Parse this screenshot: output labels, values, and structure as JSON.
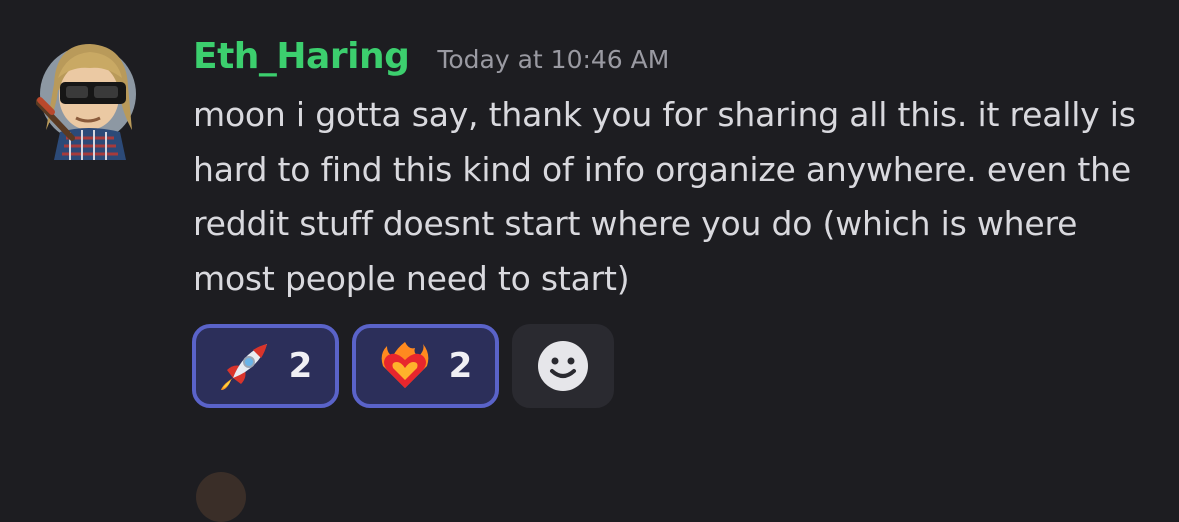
{
  "message": {
    "username": "Eth_Haring",
    "timestamp": "Today at 10:46 AM",
    "text": "moon i gotta say, thank you for sharing all this. it really is hard to find this kind of info organize anywhere. even the reddit stuff doesnt start where you do (which is where most people need to start)",
    "username_color": "#3ccf6e"
  },
  "reactions": [
    {
      "emoji": "rocket-icon",
      "count": "2",
      "selected": true
    },
    {
      "emoji": "heart-on-fire-icon",
      "count": "2",
      "selected": true
    }
  ],
  "add_reaction": {
    "icon": "smiley-icon"
  },
  "colors": {
    "background": "#1d1d21",
    "reaction_active_bg": "#2c2f5a",
    "reaction_active_border": "#5a63c9",
    "add_reaction_bg": "#2a2a30"
  }
}
